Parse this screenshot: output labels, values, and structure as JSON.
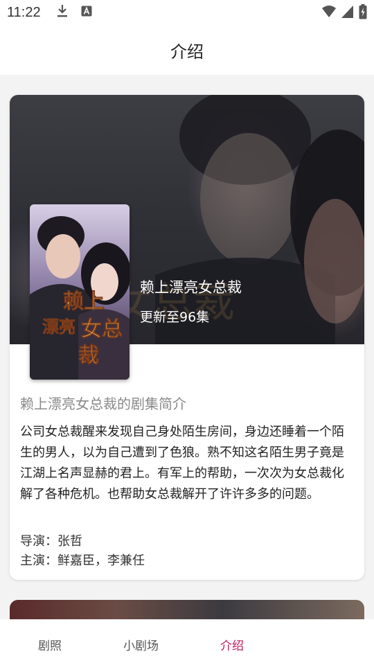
{
  "status_bar": {
    "time": "11:22",
    "left_icons": [
      "download-icon",
      "text-a-icon"
    ],
    "right_icons": [
      "wifi-icon",
      "signal-icon",
      "battery-icon"
    ]
  },
  "header": {
    "title": "介绍"
  },
  "drama": {
    "name": "赖上漂亮女总裁",
    "update": "更新至96集",
    "poster_title_chars": [
      "赖",
      "上",
      "漂",
      "亮",
      "女",
      "总",
      "裁"
    ],
    "synopsis_heading": "赖上漂亮女总裁的剧集简介",
    "synopsis": "公司女总裁醒来发现自己身处陌生房间，身边还睡着一个陌生的男人，以为自己遭到了色狼。熟不知这名陌生男子竟是江湖上名声显赫的君上。有军上的帮助，一次次为女总裁化解了各种危机。也帮助女总裁解开了许许多多的问题。",
    "director": "导演：张哲",
    "cast": "主演：鲜嘉臣，李兼任"
  },
  "bottom_nav": {
    "items": [
      {
        "label": "剧照"
      },
      {
        "label": "小剧场"
      },
      {
        "label": "介绍"
      }
    ],
    "active_color": "#c2185b"
  }
}
